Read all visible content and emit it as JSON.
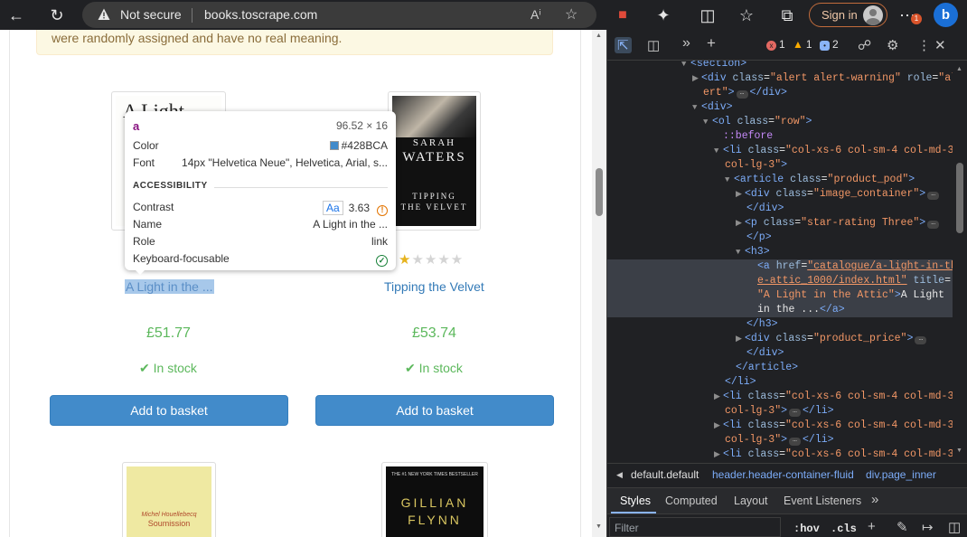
{
  "browser": {
    "not_secure": "Not secure",
    "url": "books.toscrape.com",
    "sign_in": "Sign in",
    "notification_count": "1"
  },
  "page": {
    "alert_text": "were randomly assigned and have no real meaning.",
    "products": [
      {
        "title": "A Light in the ...",
        "price": "£51.77",
        "stock": "In stock",
        "basket": "Add to basket",
        "rating": 3,
        "cover_line1": "A Light"
      },
      {
        "title": "Tipping the Velvet",
        "price": "£53.74",
        "stock": "In stock",
        "basket": "Add to basket",
        "rating": 1,
        "cover_author1": "SARAH",
        "cover_author2": "WATERS",
        "cover_title1": "TIPPING",
        "cover_title2": "THE VELVET"
      },
      {
        "cover_author": "Michel Houellebecq",
        "cover_title": "Soumission"
      },
      {
        "cover_top": "THE #1 NEW YORK TIMES BESTSELLER",
        "cover_author1": "GILLIAN",
        "cover_author2": "FLYNN"
      }
    ]
  },
  "tooltip": {
    "tag": "a",
    "size": "96.52 × 16",
    "color_label": "Color",
    "color_value": "#428BCA",
    "font_label": "Font",
    "font_value": "14px \"Helvetica Neue\", Helvetica, Arial, s...",
    "section": "ACCESSIBILITY",
    "contrast_label": "Contrast",
    "contrast_aa": "Aa",
    "contrast_value": "3.63",
    "name_label": "Name",
    "name_value": "A Light in the ...",
    "role_label": "Role",
    "role_value": "link",
    "focus_label": "Keyboard-focusable"
  },
  "devtools": {
    "errors": "1",
    "warnings": "1",
    "infos": "2",
    "breadcrumbs": [
      "default.default",
      "header.header-container-fluid",
      "div.page_inner"
    ],
    "tabs": [
      "Styles",
      "Computed",
      "Layout",
      "Event Listeners"
    ],
    "filter_placeholder": "Filter",
    "hov": ":hov",
    "cls": ".cls",
    "dom": {
      "l0_tag": "<section>",
      "l1_a": "<div ",
      "l1_attr": "class",
      "l1_val": "\"alert alert-warning\"",
      "l1_attr2": " role",
      "l1_val2": "\"al",
      "l2_val": "ert\"",
      "l2_tag": "</div>",
      "l3_tag": "<div>",
      "l4_a": "<ol ",
      "l4_attr": "class",
      "l4_val": "\"row\"",
      "l5_pseudo": "::before",
      "l6_a": "<li ",
      "l6_attr": "class",
      "l6_val": "\"col-xs-6 col-sm-4 col-md-3",
      "l7_val": "col-lg-3\"",
      "l8_a": "<article ",
      "l8_attr": "class",
      "l8_val": "\"product_pod\"",
      "l9_a": "<div ",
      "l9_attr": "class",
      "l9_val": "\"image_container\"",
      "l10_tag": "</div>",
      "l11_a": "<p ",
      "l11_attr": "class",
      "l11_val": "\"star-rating Three\"",
      "l12_tag": "</p>",
      "l13_tag": "<h3>",
      "l14_a": "<a ",
      "l14_attr": "href",
      "l14_val": "\"catalogue/a-light-in-th",
      "l15_val": "e-attic_1000/index.html\"",
      "l15_attr": " title",
      "l16_val": "\"A Light in the Attic\"",
      "l16_text": "A Light",
      "l17_text": "in the ...",
      "l17_tag": "</a>",
      "l18_tag": "</h3>",
      "l19_a": "<div ",
      "l19_attr": "class",
      "l19_val": "\"product_price\"",
      "l20_tag": "</div>",
      "l21_tag": "</article>",
      "l22_tag": "</li>",
      "l23_a": "<li ",
      "l23_attr": "class",
      "l23_val": "\"col-xs-6 col-sm-4 col-md-3",
      "l24_val": "col-lg-3\"",
      "l24_tag": "</li>",
      "l25_a": "<li ",
      "l25_attr": "class",
      "l25_val": "\"col-xs-6 col-sm-4 col-md-3",
      "l26_val": "col-lg-3\"",
      "l26_tag": "</li>",
      "l27_a": "<li ",
      "l27_attr": "class",
      "l27_val": "\"col-xs-6 col-sm-4 col-md-3"
    }
  }
}
